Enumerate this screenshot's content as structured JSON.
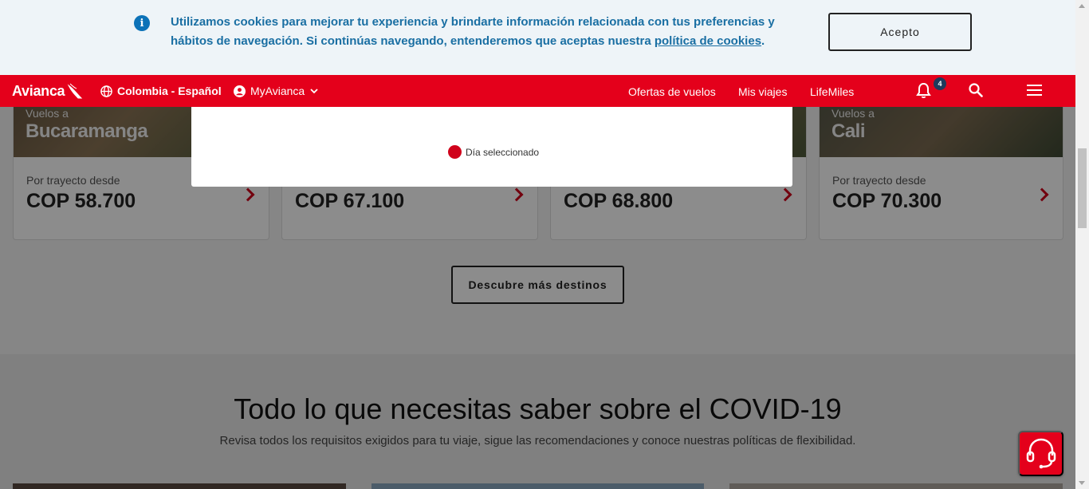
{
  "cookie_bar": {
    "message": "Utilizamos cookies para mejorar tu experiencia y brindarte información relacionada con tus preferencias y hábitos de navegación. Si continúas navegando, entenderemos que aceptas nuestra ",
    "link_text": "política de cookies",
    "message_end": ".",
    "accept_label": "Acepto",
    "icon": "info-icon"
  },
  "nav": {
    "logo": "Avianca",
    "region": "Colombia - Español",
    "account": "MyAvianca",
    "links": [
      "Ofertas de vuelos",
      "Mis viajes",
      "LifeMiles"
    ],
    "notification_count": "4"
  },
  "cards": [
    {
      "label": "Vuelos a",
      "city": "Bucaramanga",
      "from": "Por trayecto desde",
      "price": "COP 58.700"
    },
    {
      "label": "",
      "city": "",
      "from": "",
      "price": "COP 67.100"
    },
    {
      "label": "",
      "city": "",
      "from": "",
      "price": "COP 68.800"
    },
    {
      "label": "Vuelos a",
      "city": "Cali",
      "from": "Por trayecto desde",
      "price": "COP 70.300"
    }
  ],
  "discover_label": "Descubre más destinos",
  "covid": {
    "title": "Todo lo que necesitas saber sobre el COVID-19",
    "subtitle": "Revisa todos los requisitos exigidos para tu viaje, sigue las recomendaciones y conoce nuestras políticas de flexibilidad."
  },
  "modal": {
    "legend_label": "Día seleccionado",
    "legend_color": "#d0021b"
  },
  "colors": {
    "brand_red": "#e4001b",
    "cookie_text": "#1a6fa3"
  }
}
